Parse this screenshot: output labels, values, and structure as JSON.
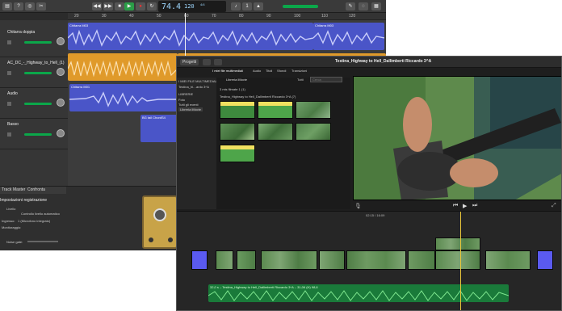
{
  "garageband": {
    "lcd": {
      "bar": "74.4",
      "tempo": "120",
      "signature": "4/4"
    },
    "ruler_numbers": [
      "20",
      "30",
      "40",
      "50",
      "60",
      "70",
      "80",
      "90",
      "100",
      "110",
      "120"
    ],
    "tracks": [
      {
        "name": "Chitarra doppia",
        "slider_color": "#0ba74a"
      },
      {
        "name": "AC_DC_-_Highway_to_Hell_(1)",
        "slider_color": "#0ba74a"
      },
      {
        "name": "Audio",
        "slider_color": "#0ba74a"
      },
      {
        "name": "Basso",
        "slider_color": "#0ba74a"
      }
    ],
    "regions": [
      {
        "label": "Chitarra M03",
        "color": "#4a55c8"
      },
      {
        "label": "Chitarra M03",
        "color": "#4a55c8"
      },
      {
        "label": "Chitarra M03",
        "color": "#4a55c8"
      },
      {
        "label": "",
        "color": "#e09a2a"
      },
      {
        "label": "Chitarra M01",
        "color": "#4a55c8"
      },
      {
        "label": "BG tail ChordS4",
        "color": "#4a55c8"
      }
    ],
    "smart_controls": {
      "tabs": [
        "Track",
        "Master",
        "Confronta"
      ],
      "title": "Impostazioni registrazione",
      "rows": [
        "Livello",
        "Controllo livello automatico",
        "Ingresso:",
        "1 (Microfono integrato)",
        "Monitoraggio:",
        "Noise gate:"
      ],
      "accent": "#c8a348"
    }
  },
  "imovie": {
    "project_button": "Progetti",
    "window_title": "Testina_Highway to Hell_Dallimberti Riccardo 3^A",
    "tabs": [
      "I miei file multimediali",
      "Audio",
      "Titoli",
      "Sfondi",
      "Transizioni"
    ],
    "sidebar": [
      "I MIEI FILE MULTIMEDIALI",
      "Testina_hi…ardo 3^A",
      "LIBRERIE",
      "Foto",
      "Tutti gli eventi",
      "Libreria iMovie"
    ],
    "browser": {
      "header": "Libreria iMovie",
      "all_clips": "Tutti",
      "search_placeholder": "Cerca",
      "group1": "3 mis filmate 1 (1)",
      "group2": "Testina_Highway to Hell_Dallimberti Riccardo 3^A (7)"
    },
    "timeline": {
      "timecode": "02:15 / 16:09",
      "audio_label": "32,0 s – Testina_Highway to Hell_Dallimberti Riccardo 3^A – 31,06 (H) 98,6",
      "accent_clip": "#5a5af0",
      "audio_color": "#1a7a3a",
      "playhead_color": "#e8c53a"
    }
  }
}
